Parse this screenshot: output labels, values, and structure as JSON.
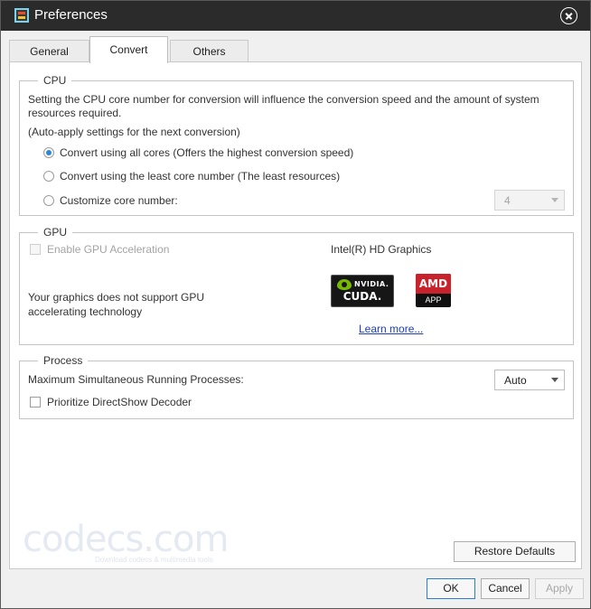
{
  "window": {
    "title": "Preferences"
  },
  "tabs": [
    {
      "label": "General",
      "active": false
    },
    {
      "label": "Convert",
      "active": true
    },
    {
      "label": "Others",
      "active": false
    }
  ],
  "cpu": {
    "legend": "CPU",
    "description_line1": "Setting the CPU core number for conversion will influence the conversion speed and the amount of system",
    "description_line2": "resources required.",
    "auto_apply": "(Auto-apply settings for the next conversion)",
    "options": [
      {
        "label": "Convert using all cores (Offers the highest conversion speed)",
        "checked": true
      },
      {
        "label": "Convert using the least core number (The least resources)",
        "checked": false
      },
      {
        "label": "Customize core number:",
        "checked": false
      }
    ],
    "core_number_value": "4"
  },
  "gpu": {
    "legend": "GPU",
    "enable_label": "Enable GPU Acceleration",
    "adapter_name": "Intel(R) HD Graphics",
    "not_supported_line1": "Your graphics does not support GPU",
    "not_supported_line2": "accelerating technology",
    "nvidia_brand": "NVIDIA.",
    "nvidia_product": "CUDA.",
    "amd_brand": "AMD",
    "amd_product": "APP",
    "learn_more": "Learn more..."
  },
  "process": {
    "legend": "Process",
    "max_label": "Maximum Simultaneous Running Processes:",
    "max_value": "Auto",
    "directshow_label": "Prioritize DirectShow Decoder"
  },
  "watermark": {
    "main": "codecs.com",
    "sub": "Download codecs & multimedia tools"
  },
  "buttons": {
    "restore": "Restore Defaults",
    "ok": "OK",
    "cancel": "Cancel",
    "apply": "Apply"
  },
  "colors": {
    "titlebar": "#2b2b2b",
    "accent": "#2a89d7",
    "link": "#1e3fb4",
    "amd_red": "#c8232c",
    "nvidia_green": "#76b900"
  },
  "icons": {
    "app": "app-icon",
    "close": "close-icon",
    "dropdown": "chevron-down-icon"
  }
}
